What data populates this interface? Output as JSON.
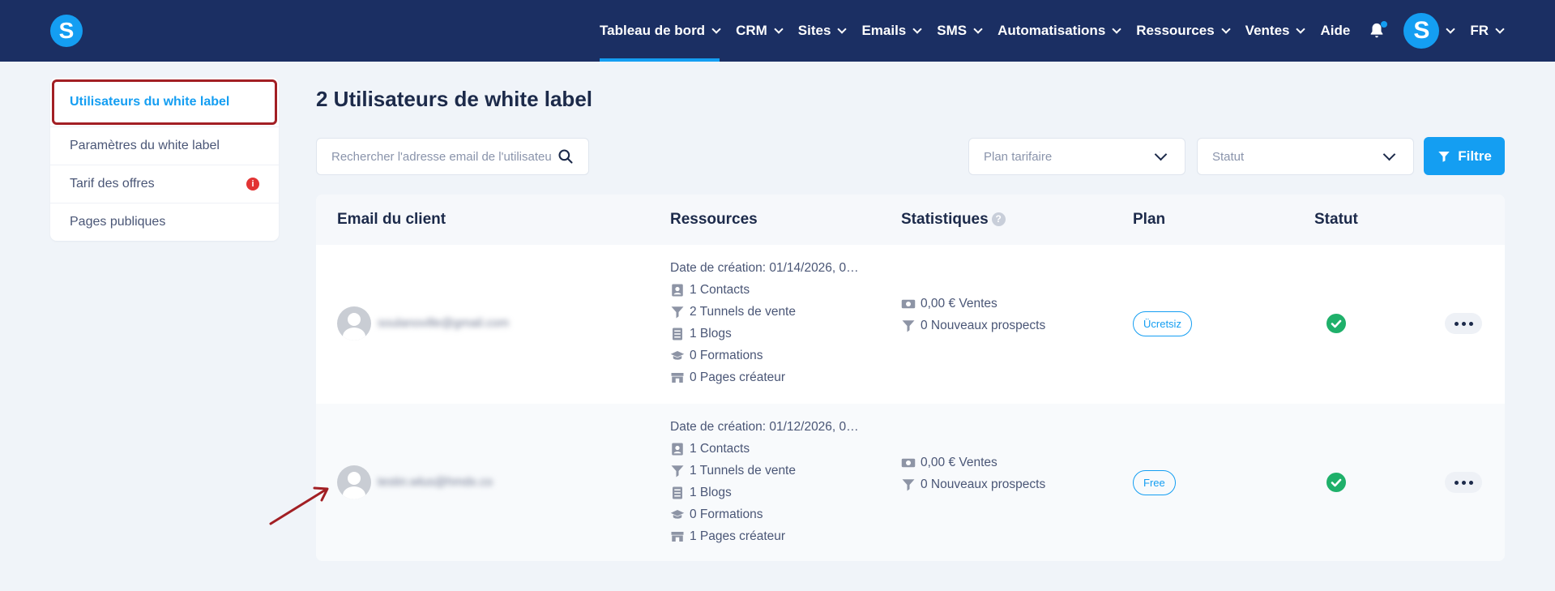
{
  "header": {
    "logo_letter": "S",
    "nav": [
      {
        "label": "Tableau de bord",
        "active": true
      },
      {
        "label": "CRM"
      },
      {
        "label": "Sites"
      },
      {
        "label": "Emails"
      },
      {
        "label": "SMS"
      },
      {
        "label": "Automatisations"
      },
      {
        "label": "Ressources"
      },
      {
        "label": "Ventes"
      }
    ],
    "help_label": "Aide",
    "avatar_letter": "S",
    "lang_label": "FR"
  },
  "sidebar": {
    "items": [
      {
        "label": "Utilisateurs du white label",
        "active": true
      },
      {
        "label": "Paramètres du white label"
      },
      {
        "label": "Tarif des offres",
        "badge": "i"
      },
      {
        "label": "Pages publiques"
      }
    ]
  },
  "main": {
    "title": "2 Utilisateurs de white label",
    "search_placeholder": "Rechercher l'adresse email de l'utilisateur",
    "plan_select": "Plan tarifaire",
    "status_select": "Statut",
    "filter_label": "Filtre"
  },
  "table": {
    "headers": {
      "email": "Email du client",
      "resources": "Ressources",
      "stats": "Statistiques",
      "help": "?",
      "plan": "Plan",
      "status": "Statut"
    },
    "rows": [
      {
        "email": "soulanoville@gmail.com",
        "date": "Date de création: 01/14/2026, 0…",
        "contacts": "1 Contacts",
        "funnels": "2 Tunnels de vente",
        "blogs": "1 Blogs",
        "courses": "0 Formations",
        "pages": "0 Pages créateur",
        "sales": "0,00 € Ventes",
        "leads": "0 Nouveaux prospects",
        "plan": "Ücretsiz",
        "status": "active"
      },
      {
        "email": "testin.wlus@hmdx.co",
        "date": "Date de création: 01/12/2026, 0…",
        "contacts": "1 Contacts",
        "funnels": "1 Tunnels de vente",
        "blogs": "1 Blogs",
        "courses": "0 Formations",
        "pages": "1 Pages créateur",
        "sales": "0,00 € Ventes",
        "leads": "0 Nouveaux prospects",
        "plan": "Free",
        "status": "active"
      }
    ]
  },
  "icons": {
    "bell": "bell-icon",
    "search": "search-icon",
    "filter": "filter-icon",
    "contacts": "contact-card-icon",
    "funnels": "funnel-icon",
    "blogs": "document-icon",
    "courses": "graduation-cap-icon",
    "pages": "store-icon",
    "sales": "money-icon",
    "status": "check-circle-icon",
    "more": "ellipsis-icon"
  },
  "colors": {
    "header_bg": "#1b2f63",
    "accent": "#149ef2",
    "page_bg": "#f0f4f9",
    "success": "#1fb06a",
    "highlight_border": "#a21f24",
    "badge": "#e23434"
  }
}
